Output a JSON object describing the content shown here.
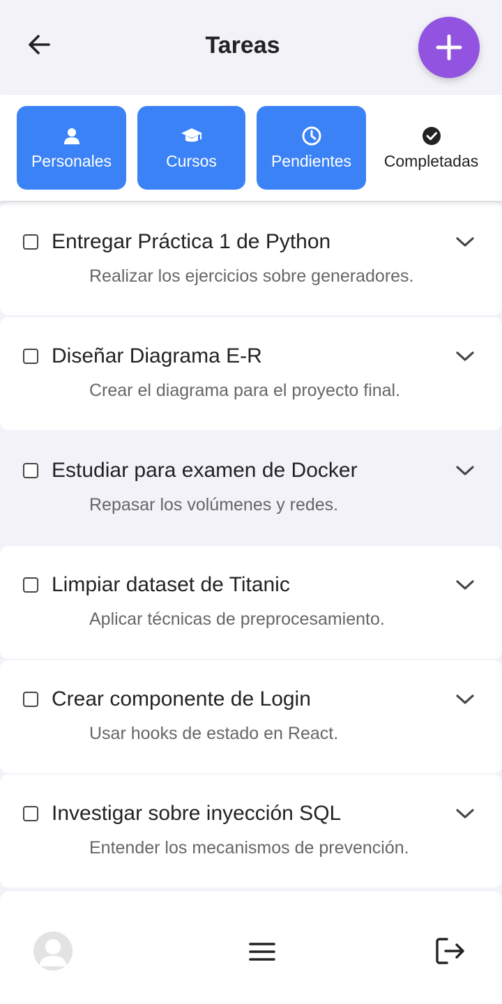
{
  "header": {
    "title": "Tareas",
    "back_icon": "arrow-left-icon",
    "add_icon": "plus-icon",
    "accent": "#9153e0"
  },
  "tabs": [
    {
      "label": "Personales",
      "icon": "user-icon",
      "active": true
    },
    {
      "label": "Cursos",
      "icon": "graduation-cap-icon",
      "active": true
    },
    {
      "label": "Pendientes",
      "icon": "clock-icon",
      "active": true
    },
    {
      "label": "Completadas",
      "icon": "check-circle-icon",
      "active": false
    }
  ],
  "tab_color": "#3b82f6",
  "tasks": [
    {
      "title": "Entregar Práctica 1 de Python",
      "description": "Realizar los ejercicios sobre generadores.",
      "checked": false
    },
    {
      "title": "Diseñar Diagrama E-R",
      "description": "Crear el diagrama para el proyecto final.",
      "checked": false
    },
    {
      "title": "Estudiar para examen de Docker",
      "description": "Repasar los volúmenes y redes.",
      "checked": false,
      "highlighted": true
    },
    {
      "title": "Limpiar dataset de Titanic",
      "description": "Aplicar técnicas de preprocesamiento.",
      "checked": false
    },
    {
      "title": "Crear componente de Login",
      "description": "Usar hooks de estado en React.",
      "checked": false
    },
    {
      "title": "Investigar sobre inyección SQL",
      "description": "Entender los mecanismos de prevención.",
      "checked": false
    }
  ],
  "bottom_bar": {
    "avatar_icon": "avatar-icon",
    "menu_icon": "hamburger-menu-icon",
    "logout_icon": "logout-icon"
  }
}
